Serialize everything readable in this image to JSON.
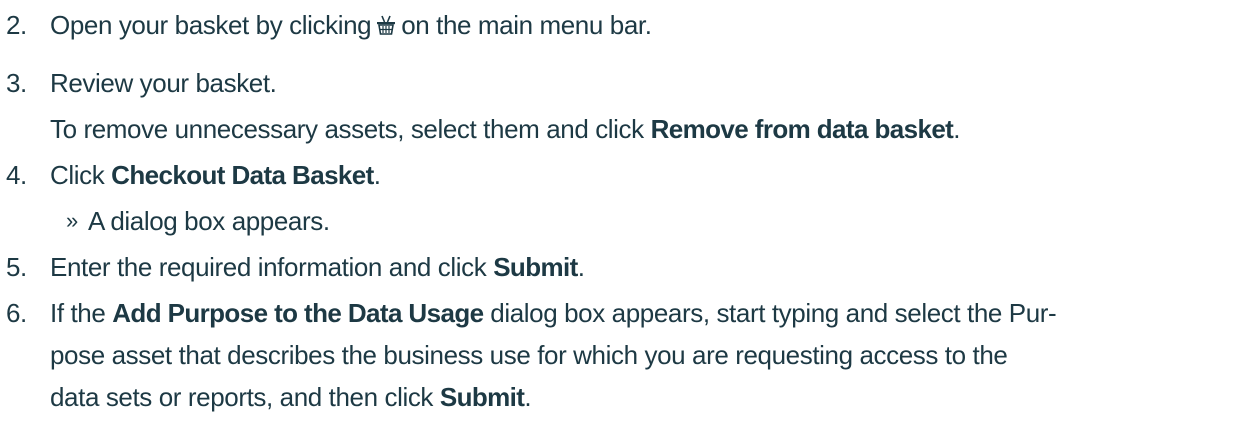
{
  "steps": [
    {
      "number": "2.",
      "before": "Open your basket by clicking",
      "icon": "basket-icon",
      "after": "on the main menu bar."
    },
    {
      "number": "3.",
      "text": "Review your basket.",
      "detail_before": "To remove unnecessary assets, select them and click",
      "detail_bold": "Remove from data basket",
      "detail_after": "."
    },
    {
      "number": "4.",
      "before": "Click",
      "bold": "Checkout Data Basket",
      "after": ".",
      "result_bullet": "»",
      "result": "A dialog box appears."
    },
    {
      "number": "5.",
      "before": "Enter the required information and click",
      "bold": "Submit",
      "after": "."
    },
    {
      "number": "6.",
      "before": "If the",
      "bold": "Add Purpose to the Data Usage",
      "after": "dialog box appears, start typing and select the Pur-",
      "line2": "pose asset that describes the business use for which you are requesting access to the",
      "line3_before": "data sets or reports, and then click",
      "line3_bold": "Submit",
      "line3_after": "."
    }
  ],
  "colors": {
    "text": "#1d3944"
  }
}
